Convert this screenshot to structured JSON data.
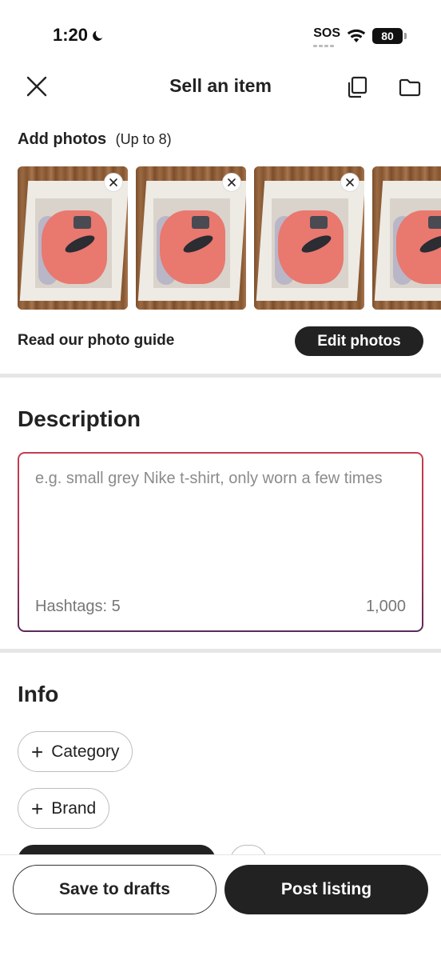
{
  "status_bar": {
    "time": "1:20",
    "sos": "SOS",
    "battery": "80",
    "icons": [
      "moon-icon",
      "wifi-icon",
      "battery-icon"
    ]
  },
  "nav": {
    "title": "Sell an item",
    "icons": [
      "close-icon",
      "copy-icon",
      "folder-icon"
    ]
  },
  "photos": {
    "heading": "Add photos",
    "limit": "(Up to 8)",
    "items": [
      {
        "subject": "pink sneakers in shoe box"
      },
      {
        "subject": "pink sneakers in shoe box"
      },
      {
        "subject": "pink sneakers in shoe box"
      },
      {
        "subject": "pink sneakers in shoe box"
      }
    ],
    "guide_link": "Read our photo guide",
    "edit_button": "Edit photos"
  },
  "description": {
    "title": "Description",
    "placeholder": "e.g. small grey Nike t-shirt, only worn a few times",
    "hashtags_label": "Hashtags: ",
    "hashtags_remaining": "5",
    "chars_remaining": "1,000",
    "border_colors": [
      "#c63c4f",
      "#5a2a5c"
    ]
  },
  "info": {
    "title": "Info",
    "chips": [
      {
        "label": "Category"
      },
      {
        "label": "Brand"
      }
    ]
  },
  "actions": {
    "save_drafts": "Save to drafts",
    "post_listing": "Post listing"
  },
  "colors": {
    "primary_dark": "#222222",
    "divider": "#e6e6e6"
  }
}
